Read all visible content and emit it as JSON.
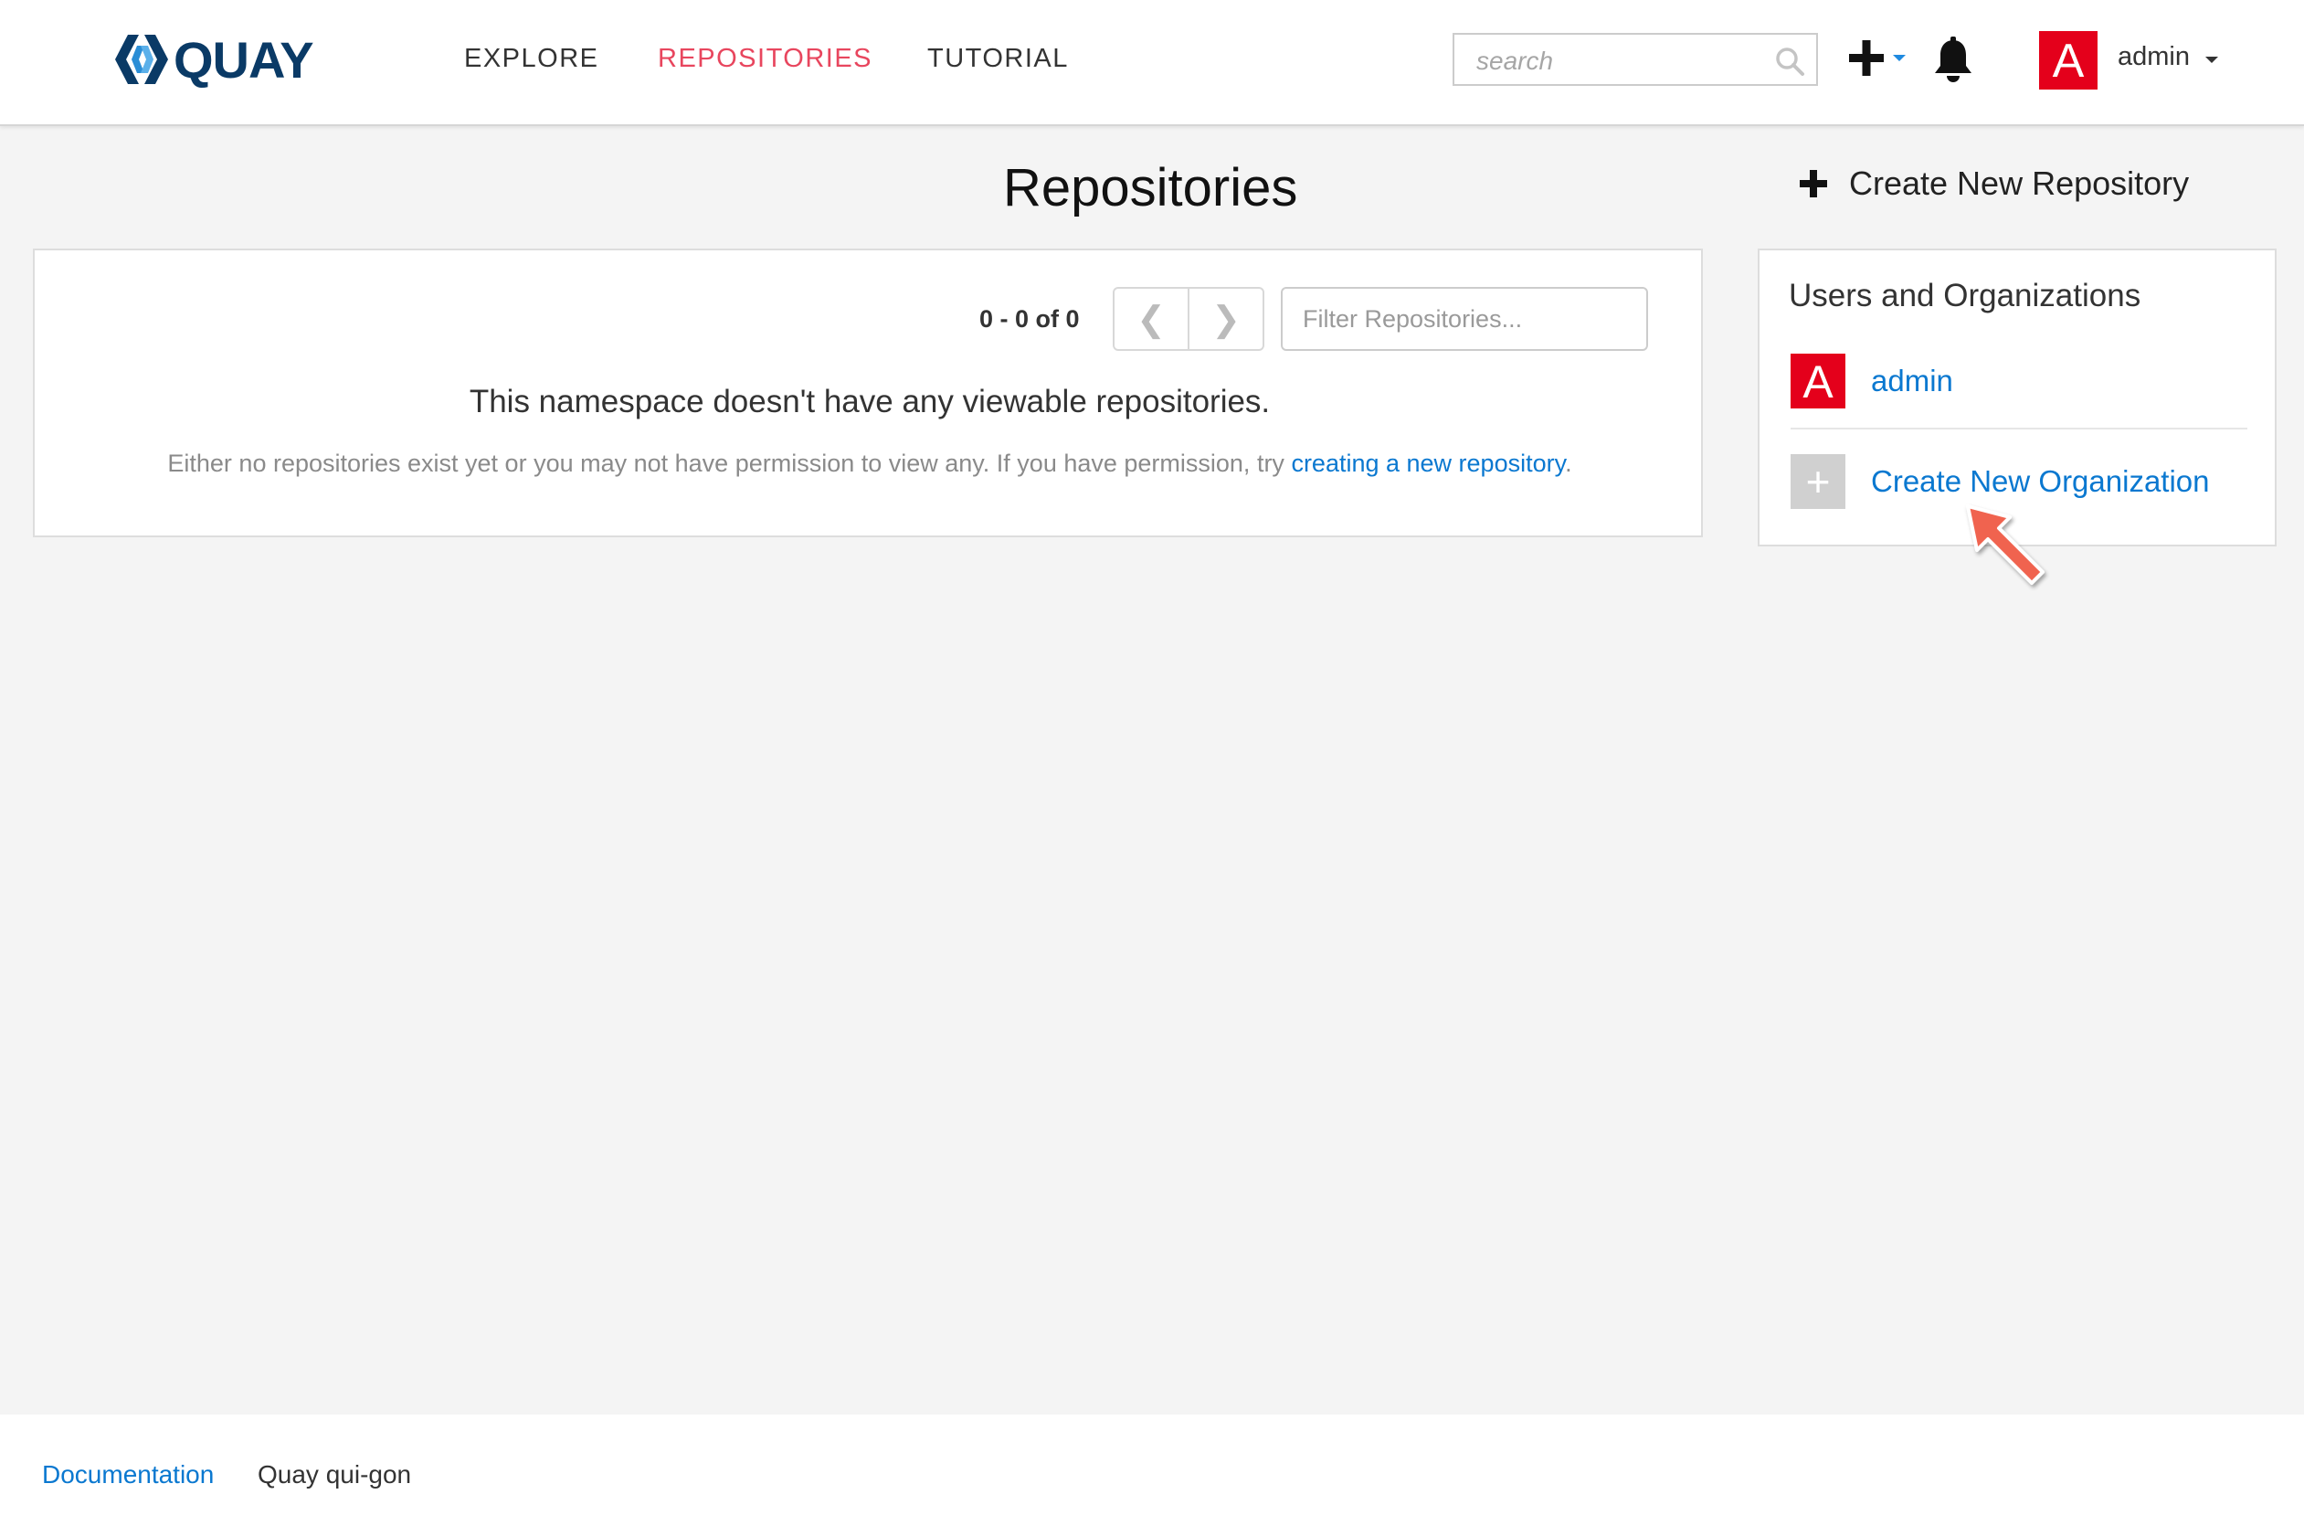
{
  "header": {
    "logo_text": "QUAY",
    "nav": [
      {
        "label": "EXPLORE"
      },
      {
        "label": "REPOSITORIES"
      },
      {
        "label": "TUTORIAL"
      }
    ],
    "active_nav": "REPOSITORIES",
    "search_placeholder": "search",
    "user": {
      "avatar_letter": "A",
      "name": "admin"
    }
  },
  "main": {
    "title": "Repositories",
    "create_repo_label": "Create New Repository",
    "pager": {
      "count_text": "0 - 0 of 0",
      "prev_glyph": "❮",
      "next_glyph": "❯"
    },
    "filter_placeholder": "Filter Repositories...",
    "empty_title": "This namespace doesn't have any viewable repositories.",
    "empty_desc_prefix": "Either no repositories exist yet or you may not have permission to view any. If you have permission, try ",
    "empty_desc_link": "creating a new repository",
    "empty_desc_suffix": "."
  },
  "sidebar": {
    "title": "Users and Organizations",
    "items": [
      {
        "avatar_letter": "A",
        "label": "admin"
      },
      {
        "avatar_glyph": "+",
        "label": "Create New Organization"
      }
    ]
  },
  "footer": {
    "doc_link": "Documentation",
    "version": "Quay qui-gon"
  },
  "colors": {
    "accent": "#e8465e",
    "link": "#0a78d0",
    "avatar": "#e4001b",
    "annotation_arrow": "#f06450"
  }
}
